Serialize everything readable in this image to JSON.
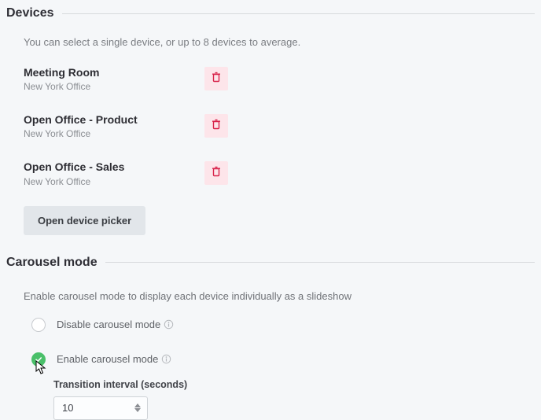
{
  "devices": {
    "title": "Devices",
    "subtext": "You can select a single device, or up to 8 devices to average.",
    "picker_label": "Open device picker",
    "items": [
      {
        "name": "Meeting Room",
        "location": "New York Office"
      },
      {
        "name": "Open Office - Product",
        "location": "New York Office"
      },
      {
        "name": "Open Office - Sales",
        "location": "New York Office"
      }
    ]
  },
  "carousel": {
    "title": "Carousel mode",
    "desc": "Enable carousel mode to display each device individually as a slideshow",
    "options": {
      "disable": "Disable carousel mode",
      "enable": "Enable carousel mode"
    },
    "interval_label": "Transition interval (seconds)",
    "interval_value": "10"
  }
}
